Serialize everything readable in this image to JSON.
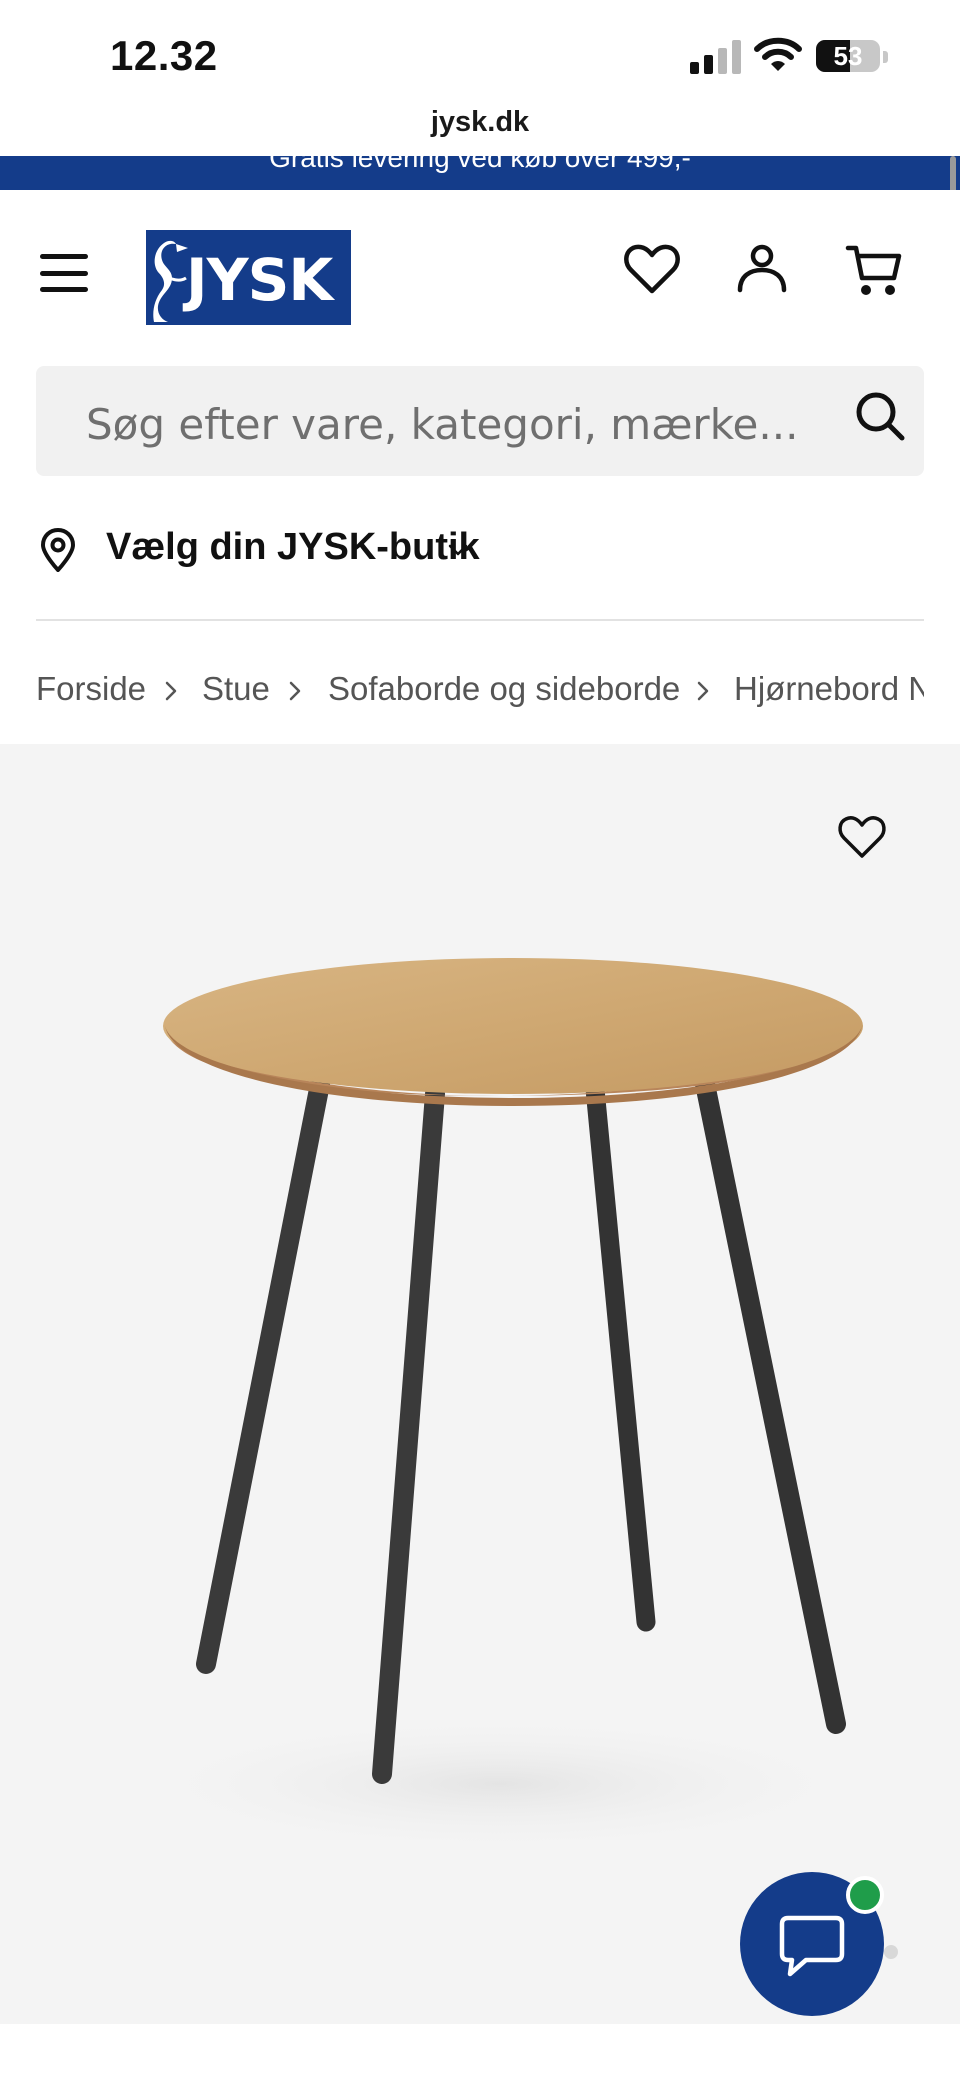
{
  "status_bar": {
    "time": "12.32",
    "battery_level": "53",
    "battery_fraction": 0.53
  },
  "browser": {
    "url": "jysk.dk"
  },
  "promo_banner": {
    "text": "Gratis levering ved køb over 499,-"
  },
  "header": {
    "logo_text": "JYSK",
    "brand_color": "#143c8a",
    "icons": [
      "menu-icon",
      "heart-icon",
      "user-icon",
      "cart-icon"
    ]
  },
  "search": {
    "placeholder": "Søg efter vare, kategori, mærke..."
  },
  "store": {
    "label": "Vælg din JYSK-butik"
  },
  "breadcrumb": {
    "items": [
      "Forside",
      "Stue",
      "Sofaborde og sideborde",
      "Hjørnebord N"
    ]
  },
  "product": {
    "image_alt": "Hjørnebord",
    "background": "#f4f4f4"
  },
  "chat": {
    "status_color": "#1f9d4a"
  }
}
